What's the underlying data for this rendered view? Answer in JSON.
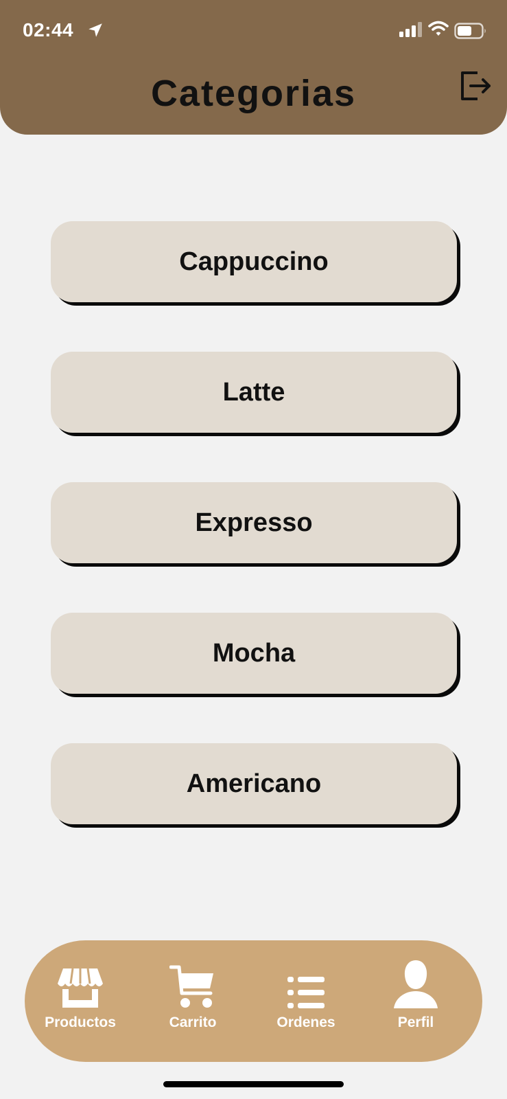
{
  "status_bar": {
    "time": "02:44",
    "icons": [
      "location-arrow-icon",
      "cellular-signal-icon",
      "wifi-icon",
      "battery-icon"
    ]
  },
  "header": {
    "title": "Categorias",
    "logout_icon": "logout-icon"
  },
  "categories": [
    {
      "label": "Cappuccino"
    },
    {
      "label": "Latte"
    },
    {
      "label": "Expresso"
    },
    {
      "label": "Mocha"
    },
    {
      "label": "Americano"
    }
  ],
  "bottom_nav": {
    "items": [
      {
        "label": "Productos",
        "icon": "store-icon"
      },
      {
        "label": "Carrito",
        "icon": "cart-icon"
      },
      {
        "label": "Ordenes",
        "icon": "list-icon"
      },
      {
        "label": "Perfil",
        "icon": "user-icon"
      }
    ]
  },
  "colors": {
    "header": "#84694b",
    "background": "#f2f2f2",
    "category_button": "#e2dbd1",
    "nav": "#cda879"
  }
}
